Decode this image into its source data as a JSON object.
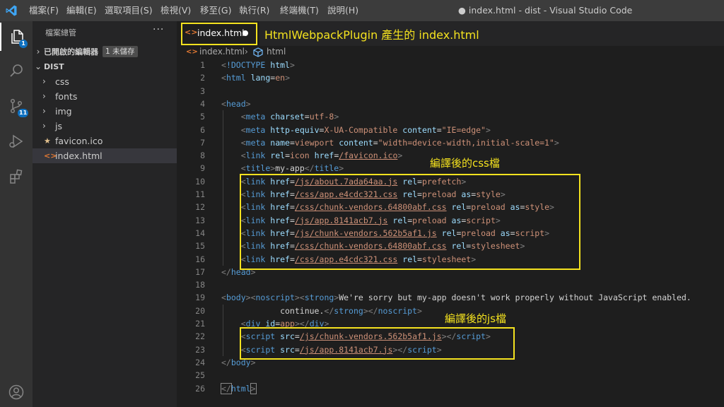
{
  "titlebar": {
    "menus": [
      "檔案(F)",
      "編輯(E)",
      "選取項目(S)",
      "檢視(V)",
      "移至(G)",
      "執行(R)",
      "終端機(T)",
      "說明(H)"
    ],
    "window_title": "● index.html - dist - Visual Studio Code"
  },
  "activity": {
    "explorer_badge": "1",
    "scm_badge": "11"
  },
  "sidebar": {
    "title": "檔案總管",
    "more": "···",
    "open_editors_label": "已開啟的編輯器",
    "unsaved_badge": "1 未儲存",
    "folder_label": "DIST",
    "items": [
      {
        "name": "css",
        "type": "folder"
      },
      {
        "name": "fonts",
        "type": "folder"
      },
      {
        "name": "img",
        "type": "folder"
      },
      {
        "name": "js",
        "type": "folder"
      },
      {
        "name": "favicon.ico",
        "type": "file-star"
      },
      {
        "name": "index.html",
        "type": "file-html"
      }
    ]
  },
  "editor": {
    "tab_label": "index.html",
    "breadcrumb": [
      "index.html",
      "html"
    ],
    "line_numbers": [
      "1",
      "2",
      "3",
      "4",
      "5",
      "6",
      "7",
      "8",
      "9",
      "10",
      "11",
      "12",
      "13",
      "14",
      "15",
      "16",
      "17",
      "18",
      "19",
      "20",
      "21",
      "22",
      "23",
      "24",
      "25",
      "26"
    ]
  },
  "annotations": {
    "plugin_note": "HtmlWebpackPlugin 產生的 index.html",
    "css_note": "編譯後的css檔",
    "js_note": "編譯後的js檔"
  },
  "colors": {
    "highlight": "#f4e21f",
    "accent": "#0e70c0"
  }
}
